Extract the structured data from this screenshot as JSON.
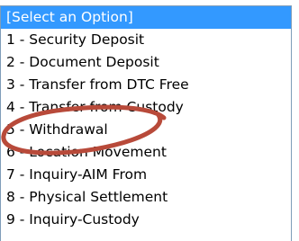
{
  "dropdown": {
    "options": [
      {
        "label": "[Select an Option]",
        "selected": true
      },
      {
        "label": "1 - Security Deposit",
        "selected": false
      },
      {
        "label": "2 - Document Deposit",
        "selected": false
      },
      {
        "label": "3 - Transfer from DTC Free",
        "selected": false
      },
      {
        "label": "4 - Transfer from Custody",
        "selected": false
      },
      {
        "label": "5 - Withdrawal",
        "selected": false
      },
      {
        "label": "6 - Location Movement",
        "selected": false
      },
      {
        "label": "7 - Inquiry-AIM From",
        "selected": false
      },
      {
        "label": "8 - Physical Settlement",
        "selected": false
      },
      {
        "label": "9 - Inquiry-Custody",
        "selected": false
      }
    ],
    "highlight_color": "#3399ff"
  },
  "annotation": {
    "type": "ellipse",
    "color": "#b84a3a",
    "target_option": "5 - Withdrawal"
  }
}
